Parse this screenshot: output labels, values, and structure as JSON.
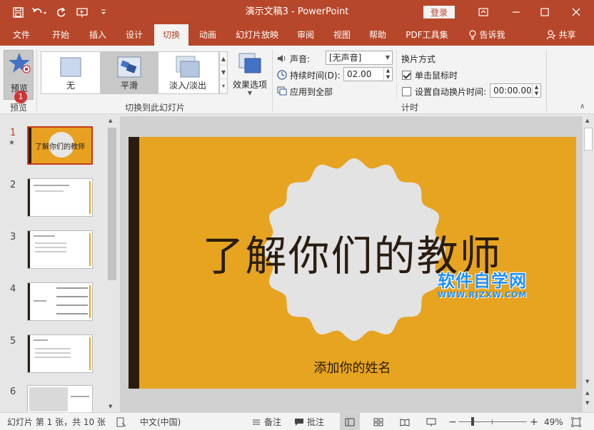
{
  "window": {
    "title": "演示文稿3 - PowerPoint",
    "login_label": "登录"
  },
  "tabs": [
    {
      "label": "文件"
    },
    {
      "label": "开始"
    },
    {
      "label": "插入"
    },
    {
      "label": "设计"
    },
    {
      "label": "切换",
      "active": true
    },
    {
      "label": "动画"
    },
    {
      "label": "幻灯片放映"
    },
    {
      "label": "审阅"
    },
    {
      "label": "视图"
    },
    {
      "label": "帮助"
    },
    {
      "label": "PDF工具集"
    },
    {
      "label": "告诉我"
    }
  ],
  "share_label": "共享",
  "ribbon": {
    "preview": {
      "label": "预览",
      "group": "预览",
      "badge": "1"
    },
    "transitions": {
      "items": [
        {
          "label": "无"
        },
        {
          "label": "平滑",
          "selected": true
        },
        {
          "label": "淡入/淡出"
        }
      ],
      "effect_options": "效果选项",
      "group": "切换到此幻灯片"
    },
    "timing": {
      "sound_label": "声音:",
      "sound_value": "[无声音]",
      "duration_label": "持续时间(D):",
      "duration_value": "02.00",
      "apply_all": "应用到全部",
      "advance_title": "换片方式",
      "on_click": "单击鼠标时",
      "on_click_checked": true,
      "auto_label": "设置自动换片时间:",
      "auto_checked": false,
      "auto_value": "00:00.00",
      "group": "计时"
    }
  },
  "slides": [
    {
      "num": "1",
      "star": "★",
      "title": "了解你们的教师"
    },
    {
      "num": "2"
    },
    {
      "num": "3"
    },
    {
      "num": "4"
    },
    {
      "num": "5"
    },
    {
      "num": "6"
    }
  ],
  "slide": {
    "title": "了解你们的教师",
    "subtitle": "添加你的姓名"
  },
  "watermark": {
    "main": "软件自学网",
    "sub": "WWW.RJZXW.COM"
  },
  "status": {
    "slide_info": "幻灯片 第 1 张，共 10 张",
    "language": "中文(中国)",
    "notes": "备注",
    "comments": "批注",
    "zoom": "49%"
  },
  "colors": {
    "accent": "#b7472a",
    "slide_bg": "#e6a420",
    "slide_dark": "#2a1d10"
  }
}
